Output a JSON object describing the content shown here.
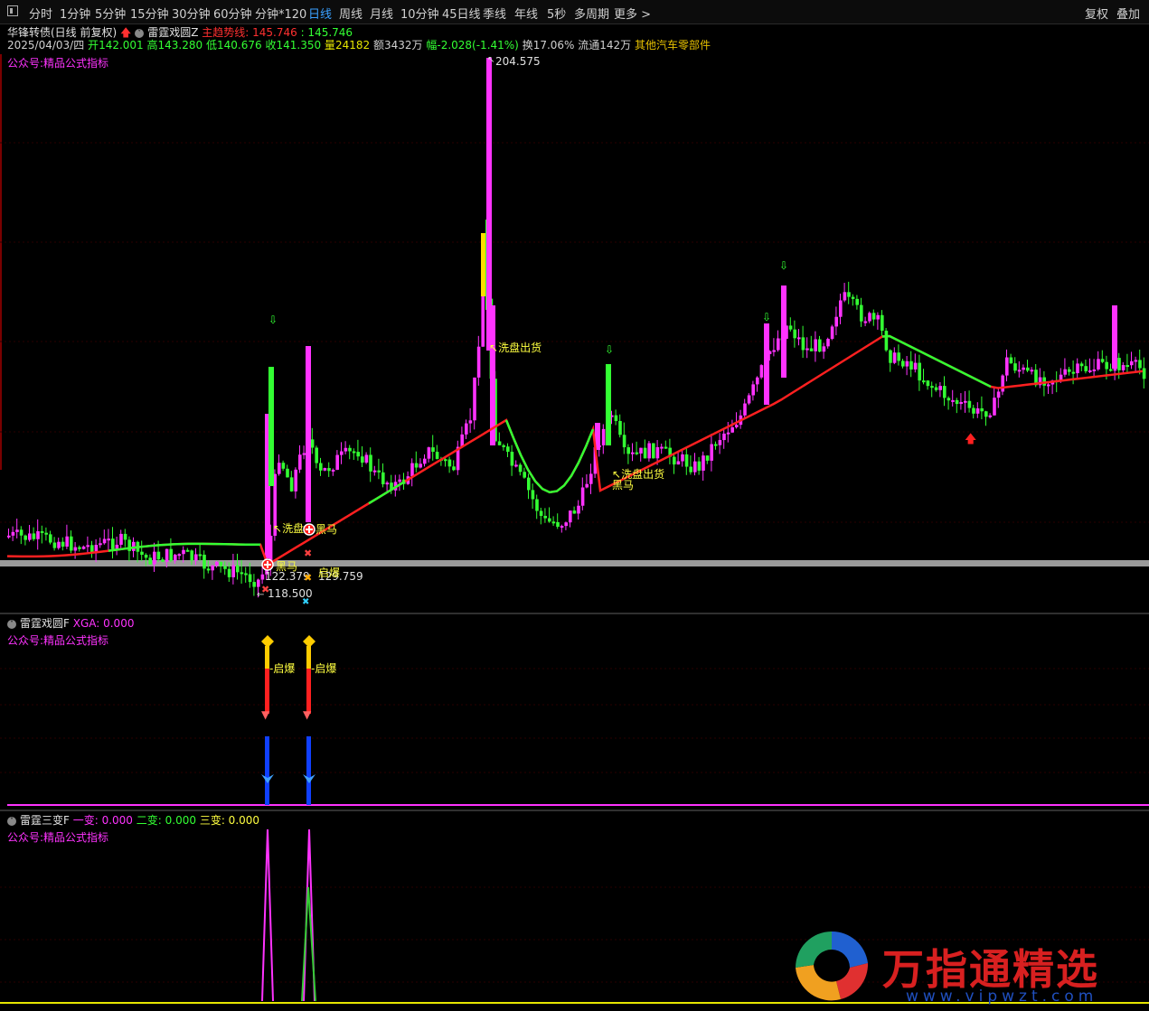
{
  "toolbar": {
    "tabs": [
      "分时",
      "1分钟",
      "5分钟",
      "15分钟",
      "30分钟",
      "60分钟",
      "分钟*120",
      "日线",
      "周线",
      "月线",
      "10分钟",
      "45日线",
      "季线",
      "年线",
      "5秒",
      "多周期",
      "更多 >"
    ],
    "active_tab": "日线",
    "right_buttons": [
      "复权",
      "叠加"
    ]
  },
  "header": {
    "stock_name": "华锋转债(日线 前复权)",
    "indicator_name": "雷霆戏圆Z",
    "trend_label": "主趋势线:",
    "trend_value": "145.746",
    "trend_value2": ": 145.746",
    "date": "2025/04/03/四",
    "open_label": "开",
    "open": "142.001",
    "high_label": "高",
    "high": "143.280",
    "low_label": "低",
    "low": "140.676",
    "close_label": "收",
    "close": "141.350",
    "vol_label": "量",
    "vol": "24182",
    "amount_label": "额",
    "amount": "3432万",
    "change_label": "幅",
    "change": "-2.028(-1.41%)",
    "turnover": "换17.06%",
    "float": "流通142万",
    "sector": "其他汽车零部件",
    "watermark_line": "公众号:精品公式指标"
  },
  "main_chart": {
    "annotations": {
      "max_price": "204.575",
      "min_price": "118.500",
      "price_a": "122.379",
      "price_b": "129.759",
      "wash_ship_1": "洗盘出货",
      "wash_ship_2": "洗盘出货",
      "wash_1": "洗盘",
      "dark_horse_1": "黑马",
      "dark_horse_2": "黑马",
      "dark_horse_3": "黑马",
      "ignite": "启爆"
    },
    "colors": {
      "up": "#ff33ff",
      "down": "#33ff33",
      "trend_up": "#ff2020",
      "trend_down": "#33ff33",
      "bg": "#000000"
    }
  },
  "panel2": {
    "title": "雷霆戏圆F",
    "value_label": "XGA: 0.000",
    "sub": "公众号:精品公式指标",
    "signal_label_1": "启爆",
    "signal_label_2": "启爆"
  },
  "panel3": {
    "title": "雷霆三变F",
    "v1": "一变: 0.000",
    "v2": "二变: 0.000",
    "v3": "三变: 0.000",
    "sub": "公众号:精品公式指标"
  },
  "watermark": {
    "cn": "万指通精选",
    "url": "www.vipwzt.com"
  }
}
